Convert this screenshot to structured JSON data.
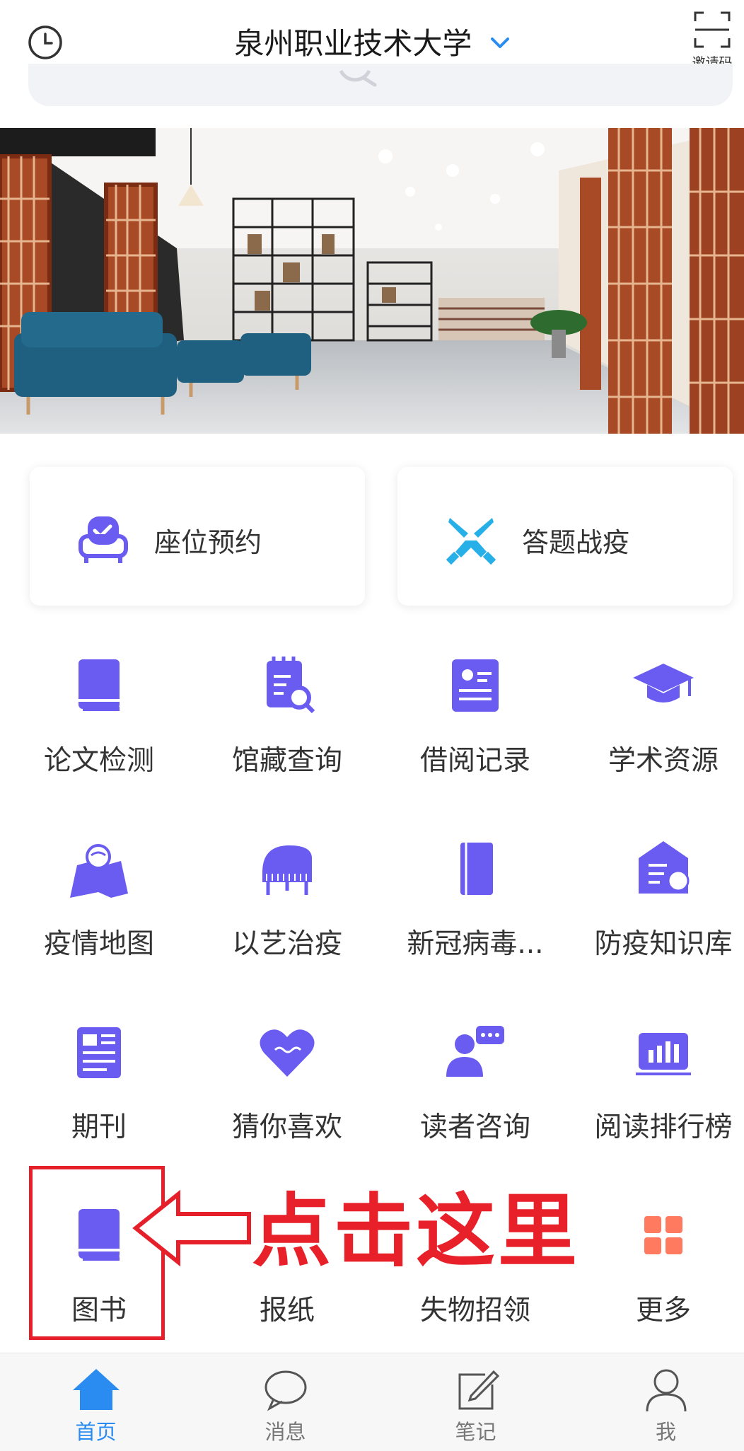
{
  "header": {
    "title": "泉州职业技术大学",
    "invite_label": "邀请码"
  },
  "quick_cards": [
    {
      "label": "座位预约",
      "icon": "seat-reservation-icon"
    },
    {
      "label": "答题战疫",
      "icon": "crossed-swords-icon"
    }
  ],
  "grid": [
    {
      "label": "论文检测",
      "icon": "book-icon"
    },
    {
      "label": "馆藏查询",
      "icon": "catalog-search-icon"
    },
    {
      "label": "借阅记录",
      "icon": "id-card-icon"
    },
    {
      "label": "学术资源",
      "icon": "graduation-cap-icon"
    },
    {
      "label": "疫情地图",
      "icon": "map-icon"
    },
    {
      "label": "以艺治疫",
      "icon": "piano-icon"
    },
    {
      "label": "新冠病毒...",
      "icon": "notebook-icon"
    },
    {
      "label": "防疫知识库",
      "icon": "knowledge-house-icon"
    },
    {
      "label": "期刊",
      "icon": "newspaper-icon"
    },
    {
      "label": "猜你喜欢",
      "icon": "heart-icon"
    },
    {
      "label": "读者咨询",
      "icon": "chat-user-icon"
    },
    {
      "label": "阅读排行榜",
      "icon": "bar-chart-icon"
    },
    {
      "label": "图书",
      "icon": "book-icon"
    },
    {
      "label": "报纸",
      "icon": "newspaper-icon"
    },
    {
      "label": "失物招领",
      "icon": "lost-found-icon"
    },
    {
      "label": "更多",
      "icon": "more-grid-icon"
    }
  ],
  "annotation": {
    "text": "点击这里"
  },
  "tabbar": [
    {
      "label": "首页",
      "active": true
    },
    {
      "label": "消息",
      "active": false
    },
    {
      "label": "笔记",
      "active": false
    },
    {
      "label": "我",
      "active": false
    }
  ],
  "colors": {
    "accent": "#6a5cf0",
    "active_tab": "#2a8cf0",
    "annotation": "#e5202a",
    "more_icon": "#ff7a5e"
  }
}
